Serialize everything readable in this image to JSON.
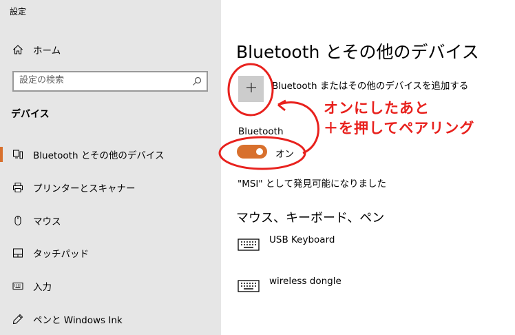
{
  "window": {
    "title": "設定"
  },
  "sidebar": {
    "home_label": "ホーム",
    "search_placeholder": "設定の検索",
    "section_label": "デバイス",
    "items": [
      {
        "label": "Bluetooth とその他のデバイス",
        "icon": "bluetooth-device-icon",
        "selected": true
      },
      {
        "label": "プリンターとスキャナー",
        "icon": "printer-icon",
        "selected": false
      },
      {
        "label": "マウス",
        "icon": "mouse-icon",
        "selected": false
      },
      {
        "label": "タッチパッド",
        "icon": "touchpad-icon",
        "selected": false
      },
      {
        "label": "入力",
        "icon": "keyboard-icon",
        "selected": false
      },
      {
        "label": "ペンと Windows Ink",
        "icon": "pen-icon",
        "selected": false
      }
    ]
  },
  "main": {
    "page_title": "Bluetooth とその他のデバイス",
    "add_device_label": "Bluetooth またはその他のデバイスを追加する",
    "bluetooth_label": "Bluetooth",
    "toggle_state": "オン",
    "discoverable_text": "\"MSI\" として発見可能になりました",
    "devices_section": "マウス、キーボード、ペン",
    "devices": [
      {
        "name": "USB Keyboard",
        "icon": "keyboard-icon"
      },
      {
        "name": "wireless dongle",
        "icon": "keyboard-icon"
      }
    ]
  },
  "annotation": {
    "line1": "オンにしたあと",
    "line2": "＋を押してペアリング",
    "color": "#e8211d"
  },
  "accent_color": "#d8702d"
}
